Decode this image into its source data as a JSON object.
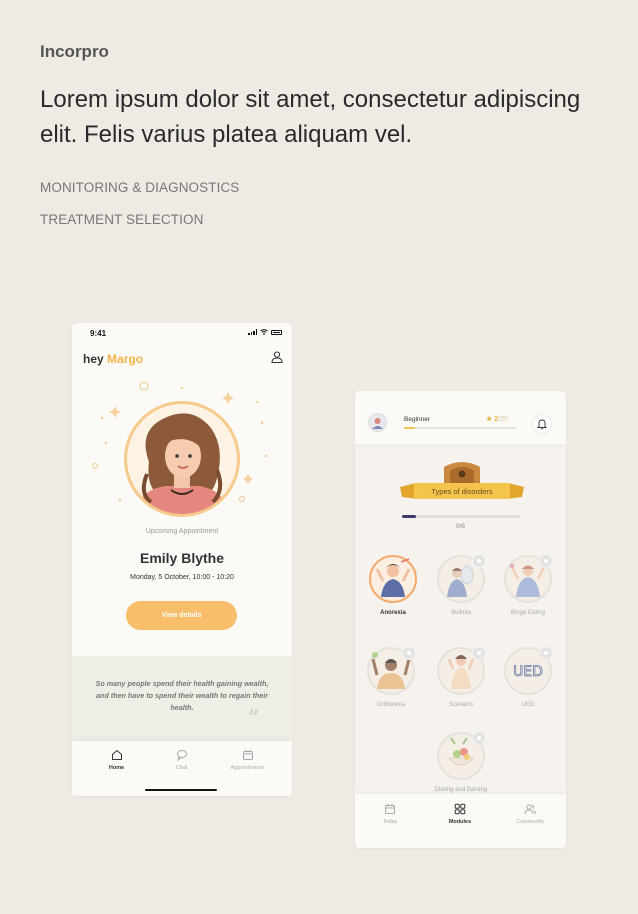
{
  "brand": "Incorpro",
  "headline": "Lorem ipsum dolor sit amet, consectetur adipiscing elit. Felis varius platea aliquam vel.",
  "categories": [
    "MONITORING & DIAGNOSTICS",
    "TREATMENT SELECTION"
  ],
  "colors": {
    "accent": "#f8be6c",
    "background": "#efeae4",
    "progress": "#3f3a6b"
  },
  "phone1": {
    "status_time": "9:41",
    "greeting_prefix": "hey",
    "greeting_name": "Margo",
    "upcoming_label": "Upcoming Appointment",
    "patient_name": "Emily Blythe",
    "appointment_time": "Monday, 5 October, 10:00 - 10:20",
    "view_button": "View details",
    "quote": "So many people spend their health gaining wealth, and then have to spend their wealth to regain their health.",
    "quote_mark": "”",
    "tabs": [
      {
        "label": "Home",
        "icon": "home-icon",
        "active": true
      },
      {
        "label": "Chat",
        "icon": "chat-icon",
        "active": false
      },
      {
        "label": "Appointments",
        "icon": "calendar-icon",
        "active": false
      }
    ]
  },
  "phone2": {
    "level_label": "Beginner",
    "level_progress": 0.1,
    "stars_current": "2",
    "stars_total": "/20",
    "banner_label": "Types of disorders",
    "progress": 0.12,
    "progress_count": "0/6",
    "modules": [
      {
        "label": "Anorexia",
        "active": true,
        "locked": false
      },
      {
        "label": "Bulimia",
        "active": false,
        "locked": true
      },
      {
        "label": "Binge Eating",
        "active": false,
        "locked": true
      },
      {
        "label": "Orthorexia",
        "active": false,
        "locked": true
      },
      {
        "label": "Scenario",
        "active": false,
        "locked": true
      },
      {
        "label": "UED",
        "active": false,
        "locked": true
      },
      {
        "label": "Dieting and Banting",
        "active": false,
        "locked": true
      }
    ],
    "ued_mark": "UED",
    "tabs": [
      {
        "label": "Today",
        "icon": "calendar-icon",
        "active": false
      },
      {
        "label": "Modules",
        "icon": "grid-icon",
        "active": true
      },
      {
        "label": "Community",
        "icon": "community-icon",
        "active": false
      }
    ]
  }
}
